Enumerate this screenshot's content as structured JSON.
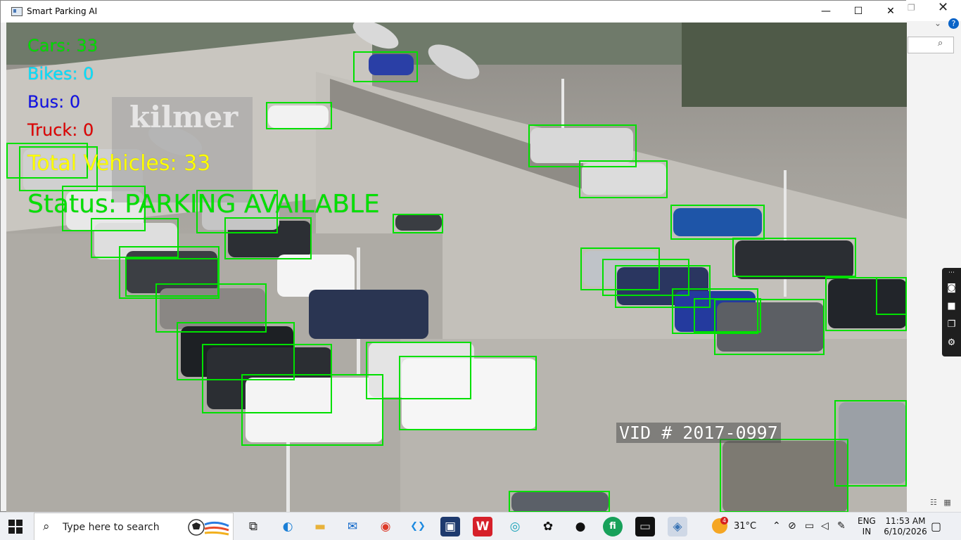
{
  "window": {
    "title": "Smart Parking AI",
    "minimize": "—",
    "maximize": "☐",
    "close": "✕"
  },
  "overlay": {
    "cars": "Cars: 33",
    "bikes": "Bikes: 0",
    "bus": "Bus: 0",
    "truck": "Truck: 0",
    "total": "Total Vehicles: 33",
    "status": "Status: PARKING AVAILABLE",
    "video_id": "VID # 2017-0997",
    "watermark": "kilmer"
  },
  "colors": {
    "cars": "#00e000",
    "bikes": "#00e0ff",
    "bus": "#1010e8",
    "truck": "#e00000",
    "total": "#ffff00",
    "detection_box": "#00e000"
  },
  "taskbar": {
    "search_placeholder": "Type here to search",
    "apps": [
      {
        "name": "task-view-icon",
        "glyph": "⧉"
      },
      {
        "name": "edge-icon",
        "glyph": "◐"
      },
      {
        "name": "file-explorer-icon",
        "glyph": "▬"
      },
      {
        "name": "outlook-icon",
        "glyph": "✉"
      },
      {
        "name": "chrome-icon",
        "glyph": "◉"
      },
      {
        "name": "vscode-icon",
        "glyph": "❮❯"
      },
      {
        "name": "remote-desktop-icon",
        "glyph": "▣"
      },
      {
        "name": "wps-icon",
        "glyph": "W"
      },
      {
        "name": "copilot-icon",
        "glyph": "◎"
      },
      {
        "name": "chatgpt-icon",
        "glyph": "✿"
      },
      {
        "name": "github-icon",
        "glyph": "●"
      },
      {
        "name": "fi-app-icon",
        "glyph": "fi"
      },
      {
        "name": "terminal-icon",
        "glyph": "▭"
      },
      {
        "name": "python-icon",
        "glyph": "◈"
      }
    ],
    "weather_badge": "4",
    "temperature": "31°C",
    "language_line1": "ENG",
    "language_line2": "IN",
    "time": "11:53 AM",
    "date": "6/10/2026"
  }
}
